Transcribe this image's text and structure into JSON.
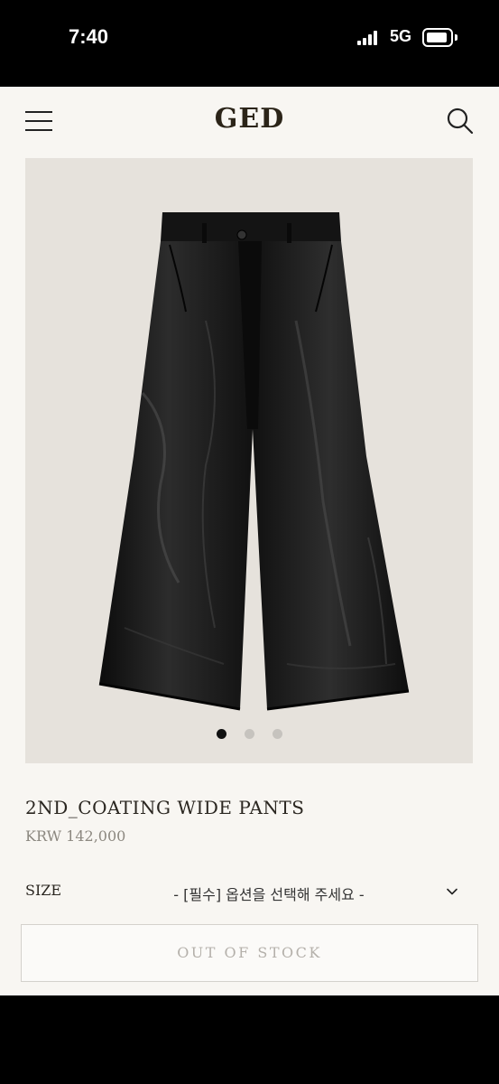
{
  "status_bar": {
    "time": "7:40",
    "network": "5G",
    "icons": [
      "signal-icon",
      "battery-icon"
    ]
  },
  "header": {
    "logo": "GED",
    "menu_icon": "menu-icon",
    "search_icon": "search-icon"
  },
  "gallery": {
    "image": "black coated wide pants",
    "slide_count": 3,
    "active_slide": 1
  },
  "product": {
    "name": "2ND_COATING WIDE PANTS",
    "price": "KRW 142,000"
  },
  "options": {
    "size_label": "SIZE",
    "size_placeholder": "- [필수] 옵션을 선택해 주세요 -",
    "dropdown_icon": "chevron-down-icon"
  },
  "actions": {
    "out_of_stock_label": "OUT OF STOCK"
  },
  "colors": {
    "background": "#f8f6f2",
    "gallery_bg": "#e6e2dc",
    "logo": "#2b2418",
    "muted_text": "#8c8880",
    "disabled_text": "#b4b0aa"
  }
}
